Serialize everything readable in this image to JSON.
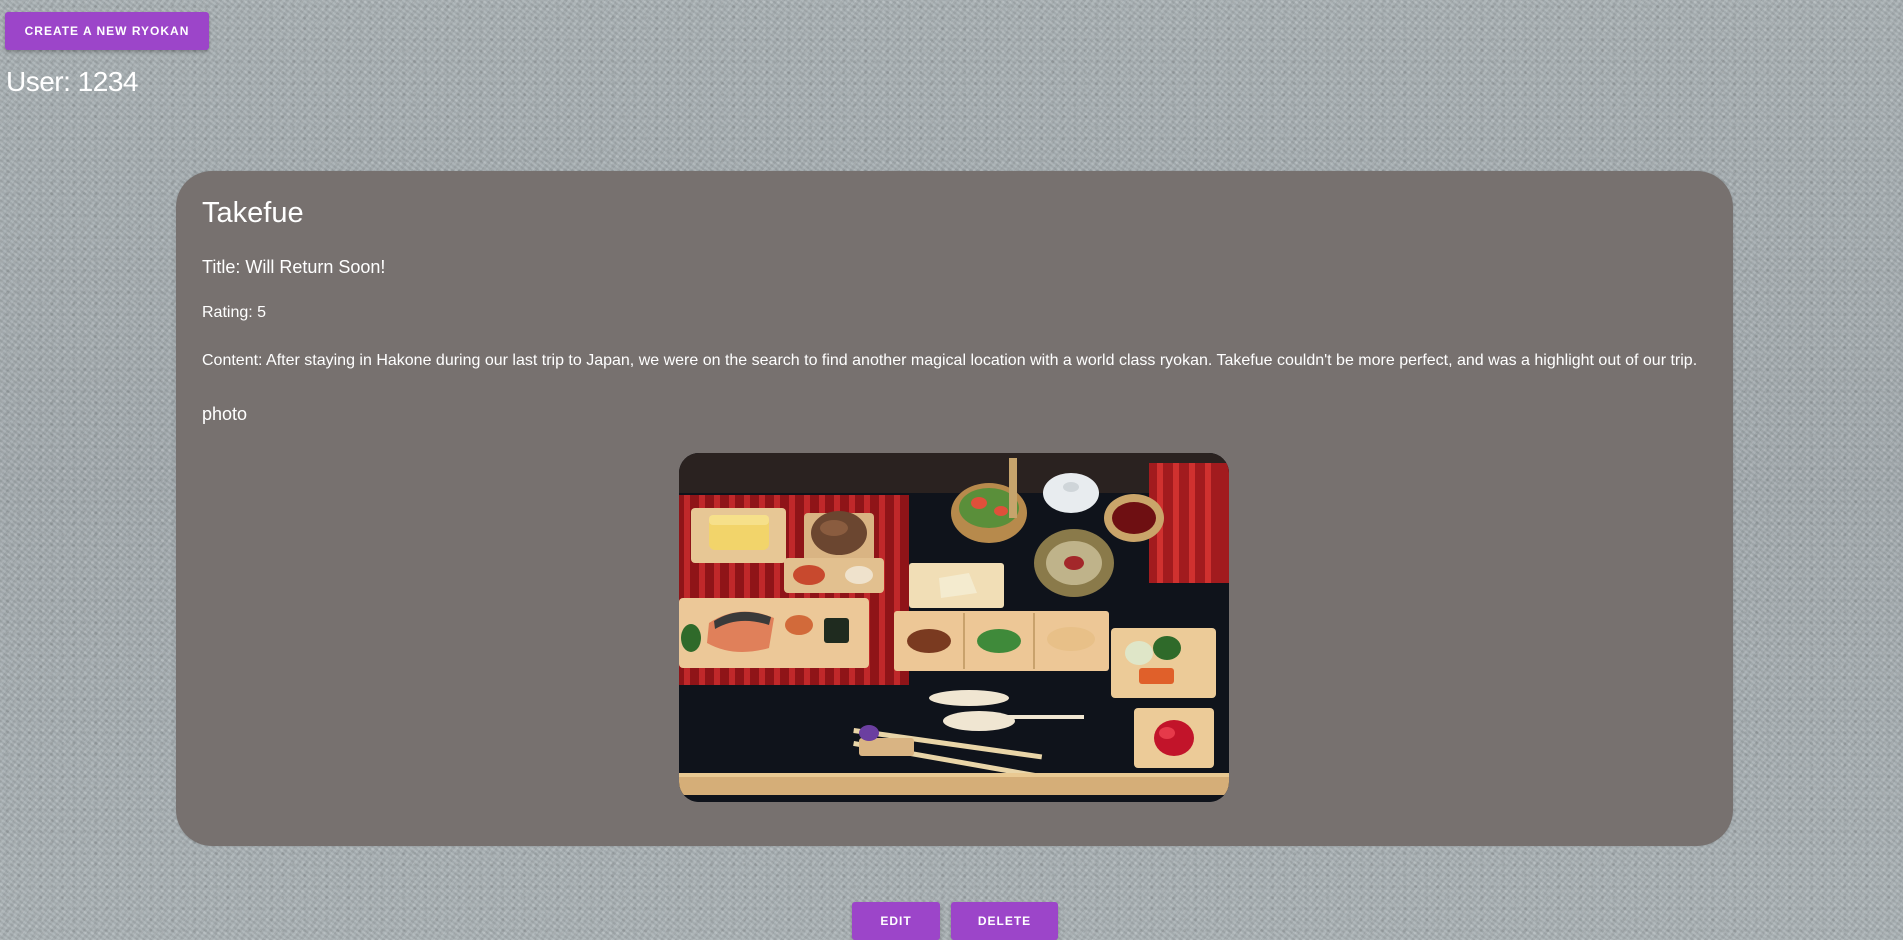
{
  "header": {
    "create_button_label": "CREATE A NEW RYOKAN",
    "user_label": "User: 1234"
  },
  "card": {
    "ryokan_name": "Takefue",
    "title_line": "Title: Will Return Soon!",
    "rating_line": "Rating: 5",
    "content_line": "Content: After staying in Hakone during our last trip to Japan, we were on the search to find another magical location with a world class ryokan. Takefue couldn't be more perfect, and was a highlight out of our trip.",
    "photo_label": "photo"
  },
  "actions": {
    "edit_label": "EDIT",
    "delete_label": "DELETE"
  },
  "colors": {
    "accent": "#9c45c9",
    "card_background": "#77716f",
    "page_background": "#a7afb2"
  }
}
